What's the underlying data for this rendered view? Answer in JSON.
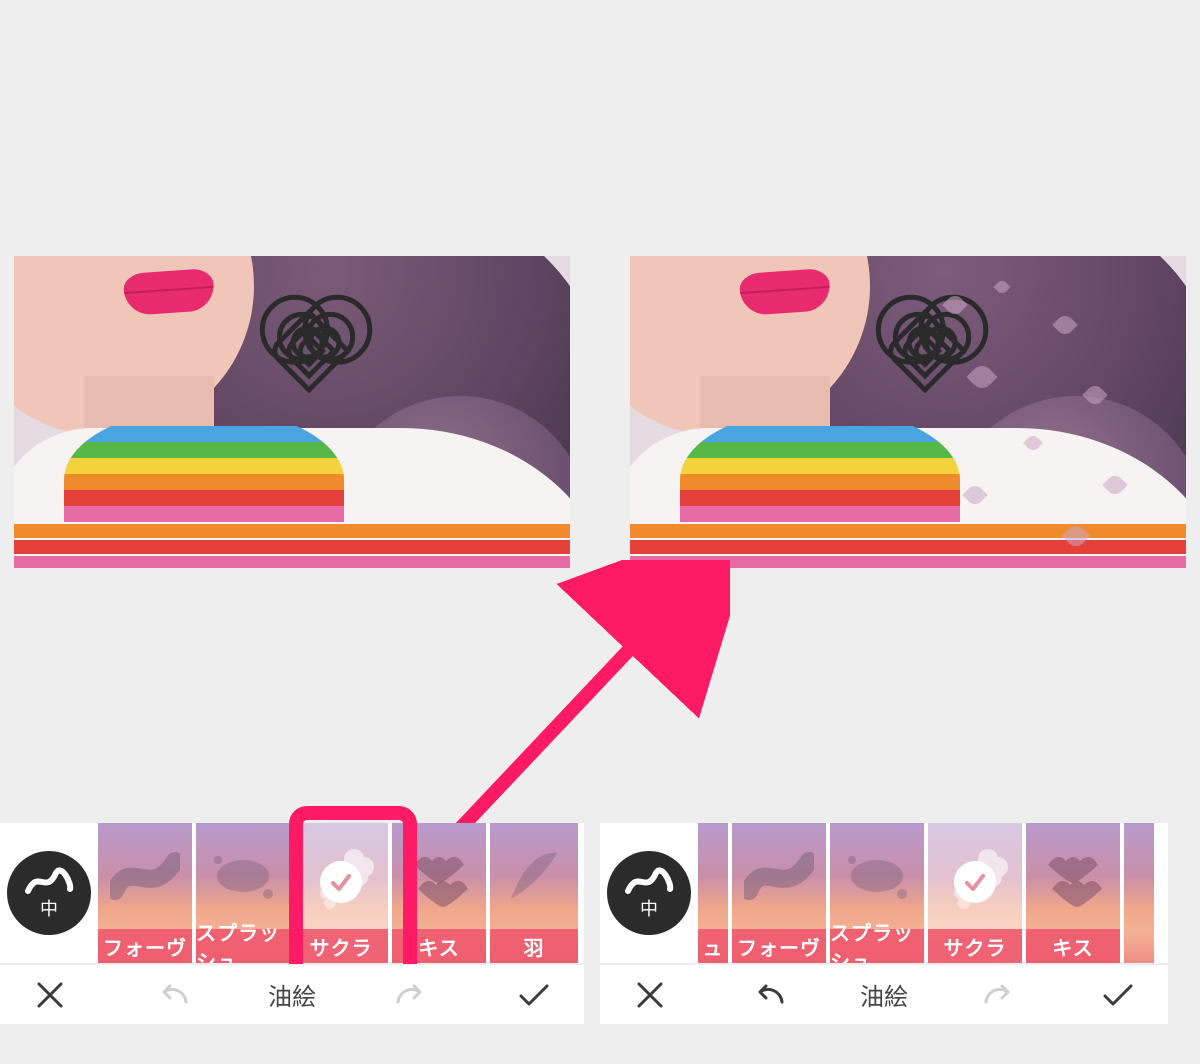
{
  "brush": {
    "size_label": "中"
  },
  "toolbar": {
    "title": "油絵"
  },
  "colors": {
    "accent": "#ff1a66",
    "filter_label_bg": "#ef5a6e",
    "brush_button_bg": "#2b2b2b"
  },
  "left_panel": {
    "selected_index": 2,
    "filters": [
      {
        "id": "fauve",
        "label": "フォーヴ"
      },
      {
        "id": "splash",
        "label": "スプラッシュ"
      },
      {
        "id": "sakura",
        "label": "サクラ",
        "selected": true
      },
      {
        "id": "kiss",
        "label": "キス"
      },
      {
        "id": "feather",
        "label": "羽"
      }
    ],
    "undo_enabled": false,
    "redo_enabled": false
  },
  "right_panel": {
    "selected_index": 3,
    "filters": [
      {
        "id": "splash_tail",
        "label": "ュ"
      },
      {
        "id": "fauve",
        "label": "フォーヴ"
      },
      {
        "id": "splash",
        "label": "スプラッシュ"
      },
      {
        "id": "sakura",
        "label": "サクラ",
        "selected": true
      },
      {
        "id": "kiss",
        "label": "キス"
      }
    ],
    "undo_enabled": true,
    "redo_enabled": false
  },
  "sweater_stripes": [
    "#4aa4e0",
    "#55b748",
    "#f4d23c",
    "#ef8a2d",
    "#e4413a",
    "#e66aa4"
  ]
}
